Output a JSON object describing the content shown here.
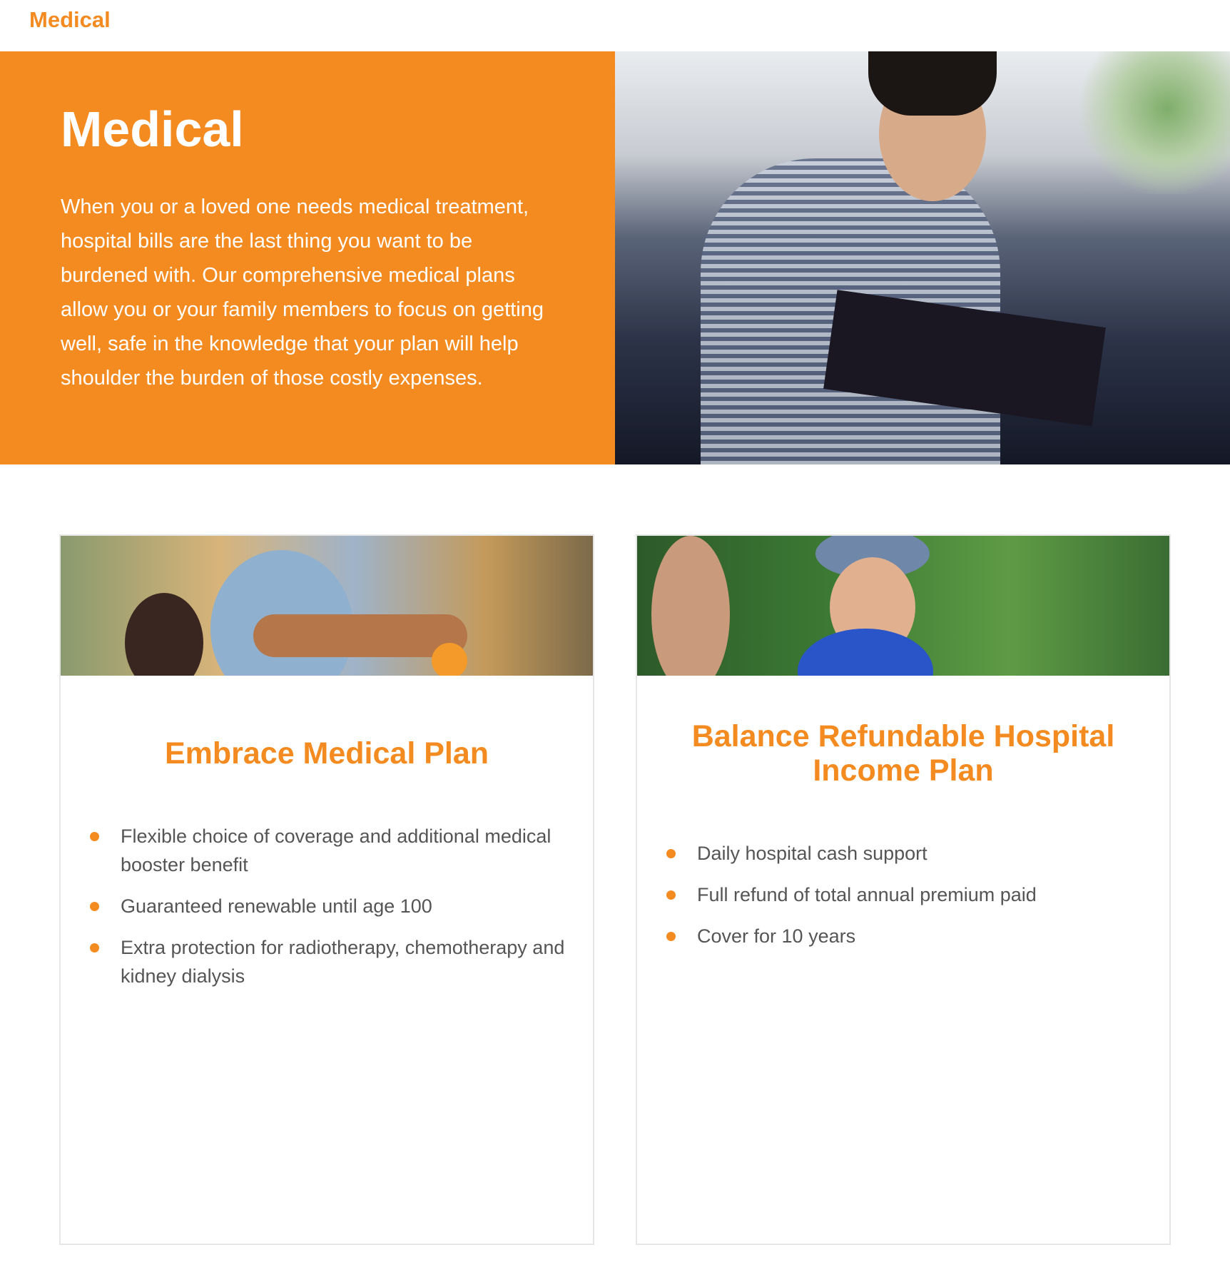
{
  "header": {
    "label": "Medical"
  },
  "hero": {
    "title": "Medical",
    "body": "When you or a loved one needs medical treatment, hospital bills are the last thing you want to be burdened with. Our comprehensive medical plans allow you or your family members to focus on getting well, safe in the knowledge that your plan will help shoulder the burden of those costly expenses."
  },
  "cards": [
    {
      "title": "Embrace Medical Plan",
      "bullets": [
        "Flexible choice of coverage and additional medical booster benefit",
        "Guaranteed renewable until age 100",
        "Extra protection for radiotherapy, chemotherapy and kidney dialysis"
      ]
    },
    {
      "title": "Balance Refundable Hospital Income Plan",
      "bullets": [
        "Daily hospital cash support",
        "Full refund of total annual premium paid",
        "Cover for 10 years"
      ]
    }
  ],
  "colors": {
    "accent": "#f48b21",
    "text": "#555555"
  }
}
